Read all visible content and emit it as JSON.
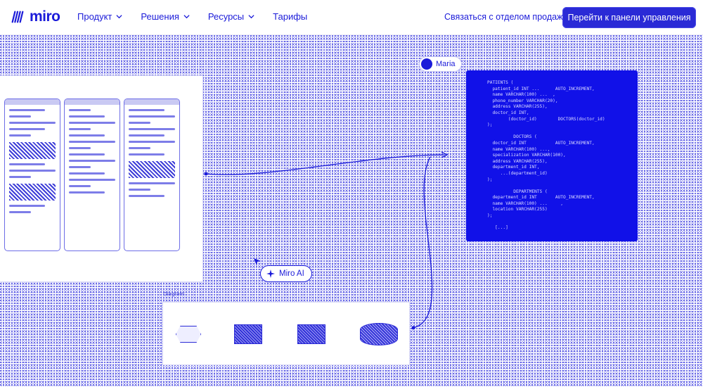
{
  "brand": {
    "name": "miro",
    "accent": "#1b1bd9",
    "button_bg": "#2a2ad6",
    "code_bg": "#1111e8"
  },
  "nav": {
    "items": [
      {
        "label": "Продукт",
        "has_dropdown": true
      },
      {
        "label": "Решения",
        "has_dropdown": true
      },
      {
        "label": "Ресурсы",
        "has_dropdown": true
      },
      {
        "label": "Тарифы",
        "has_dropdown": false
      }
    ],
    "sales_link": "Связаться с отделом продаж",
    "cta": "Перейти к панели управления"
  },
  "board": {
    "collaborator": "Maria",
    "ai_button": "Miro AI",
    "code_snippet": "PATIENTS (\n  patient_id INT ...      AUTO_INCREMENT,\n  name VARCHAR(100) ...  ,\n  phone_number VARCHAR(20),\n  address VARCHAR(255),\n  doctor_id INT,\n        (doctor_id)        DOCTORS(doctor_id)\n);\n\n          DOCTORS (\n  doctor_id INT           AUTO_INCREMENT,\n  name VARCHAR(100) ...,\n  specialization VARCHAR(100),\n  address VARCHAR(255),\n  department_id INT,\n     ...(department_id)\n);\n\n          DEPARTMENTS (\n  department_id INT       AUTO_INCREMENT,\n  name VARCHAR(100) ...     ,\n  location VARCHAR(255)\n);\n\n   [...]",
    "diagram_label": "Diagram"
  }
}
